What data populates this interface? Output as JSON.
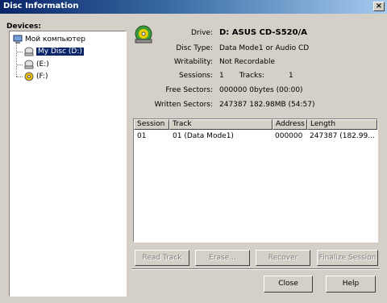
{
  "window": {
    "title": "Disc Information",
    "close_symbol": "×"
  },
  "devices": {
    "label": "Devices:",
    "root": "Мой компьютер",
    "items": [
      {
        "label": "My Disc (D:)",
        "selected": true,
        "icon": "cd-drive-icon"
      },
      {
        "label": "(E:)",
        "selected": false,
        "icon": "cd-drive-icon"
      },
      {
        "label": "(F:)",
        "selected": false,
        "icon": "dvd-drive-icon"
      }
    ]
  },
  "info": {
    "drive_label": "Drive:",
    "drive_value": "D: ASUS CD-S520/A",
    "disc_type_label": "Disc Type:",
    "disc_type_value": "Data Mode1 or Audio CD",
    "writability_label": "Writability:",
    "writability_value": "Not Recordable",
    "sessions_label": "Sessions:",
    "sessions_value": "1",
    "tracks_label": "Tracks:",
    "tracks_value": "1",
    "free_label": "Free Sectors:",
    "free_value": "000000  0bytes  (00:00)",
    "written_label": "Written Sectors:",
    "written_value": "247387  182.98MB  (54:57)"
  },
  "table": {
    "headers": [
      "Session",
      "Track",
      "Address",
      "Length"
    ],
    "rows": [
      [
        "01",
        "01  (Data Mode1)",
        "000000",
        "247387 (182.99..."
      ]
    ]
  },
  "buttons": {
    "read_track": "Read Track",
    "erase": "Erase...",
    "recover": "Recover",
    "finalize": "Finalize Session",
    "close": "Close",
    "help": "Help"
  },
  "colors": {
    "accent": "#0a246a",
    "face": "#d4d0c8"
  }
}
